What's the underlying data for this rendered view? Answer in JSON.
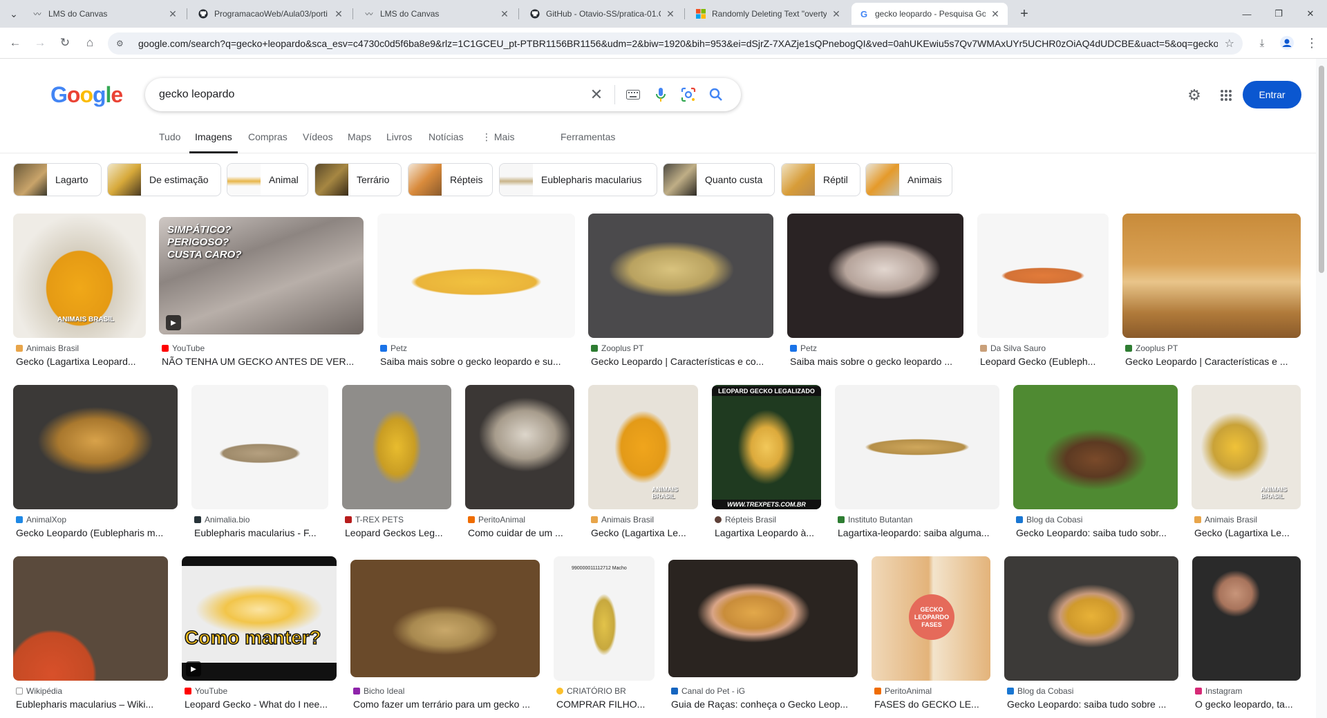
{
  "browser": {
    "tabs": [
      {
        "title": "LMS do Canvas",
        "icon": "canvas-icon"
      },
      {
        "title": "ProgramacaoWeb/Aula03/porti",
        "icon": "github-icon"
      },
      {
        "title": "LMS do Canvas",
        "icon": "canvas-icon"
      },
      {
        "title": "GitHub - Otavio-SS/pratica-01.C",
        "icon": "github-icon"
      },
      {
        "title": "Randomly Deleting Text \"overty",
        "icon": "microsoft-icon"
      },
      {
        "title": "gecko leopardo - Pesquisa Goo",
        "icon": "google-icon",
        "active": true
      }
    ],
    "url": "google.com/search?q=gecko+leopardo&sca_esv=c4730c0d5f6ba8e9&rlz=1C1GCEU_pt-PTBR1156BR1156&udm=2&biw=1920&bih=953&ei=dSjrZ-7XAZje1sQPnebogQI&ved=0ahUKEwiu5s7Qv7WMAxUYr5UCHR0zOiAQ4dUDCBE&uact=5&oq=gecko..."
  },
  "google": {
    "logo_letters": [
      {
        "char": "G",
        "color": "#4285f4"
      },
      {
        "char": "o",
        "color": "#ea4335"
      },
      {
        "char": "o",
        "color": "#fbbc05"
      },
      {
        "char": "g",
        "color": "#4285f4"
      },
      {
        "char": "l",
        "color": "#34a853"
      },
      {
        "char": "e",
        "color": "#ea4335"
      }
    ],
    "query": "gecko leopardo",
    "signin_label": "Entrar",
    "nav_tabs": [
      "Tudo",
      "Imagens",
      "Compras",
      "Vídeos",
      "Maps",
      "Livros",
      "Notícias",
      "⋮ Mais",
      "Ferramentas"
    ],
    "active_tab": "Imagens",
    "chips": [
      "Lagarto",
      "De estimação",
      "Animal",
      "Terrário",
      "Répteis",
      "Eublepharis macularius",
      "Quanto custa",
      "Réptil",
      "Animais"
    ]
  },
  "results": [
    {
      "source": "Animais Brasil",
      "caption": "Gecko (Lagartixa Leopard..."
    },
    {
      "source": "YouTube",
      "caption": "NÃO TENHA UM GECKO ANTES DE VER...",
      "overlay": "SIMPÁTICO?\nPERIGOSO?\nCUSTA CARO?",
      "video": true
    },
    {
      "source": "Petz",
      "caption": "Saiba mais sobre o gecko leopardo e su..."
    },
    {
      "source": "Zooplus PT",
      "caption": "Gecko Leopardo | Características e co..."
    },
    {
      "source": "Petz",
      "caption": "Saiba mais sobre o gecko leopardo ..."
    },
    {
      "source": "Da Silva Sauro",
      "caption": "Leopard Gecko (Eubleph..."
    },
    {
      "source": "Zooplus PT",
      "caption": "Gecko Leopardo | Características e ..."
    },
    {
      "source": "AnimalXop",
      "caption": "Gecko Leopardo (Eublepharis m..."
    },
    {
      "source": "Animalia.bio",
      "caption": "Eublepharis macularius - F..."
    },
    {
      "source": "T-REX PETS",
      "caption": "Leopard Geckos Leg..."
    },
    {
      "source": "PeritoAnimal",
      "caption": "Como cuidar de um ..."
    },
    {
      "source": "Animais Brasil",
      "caption": "Gecko (Lagartixa Le..."
    },
    {
      "source": "Répteis Brasil",
      "caption": "Lagartixa Leopardo à...",
      "overlay": "LEOPARD GECKO LEGALIZADO"
    },
    {
      "source": "Instituto Butantan",
      "caption": "Lagartixa-leopardo: saiba alguma..."
    },
    {
      "source": "Blog da Cobasi",
      "caption": "Gecko Leopardo: saiba tudo sobr..."
    },
    {
      "source": "Animais Brasil",
      "caption": "Gecko (Lagartixa Le..."
    },
    {
      "source": "Wikipédia",
      "caption": "Eublepharis macularius – Wiki..."
    },
    {
      "source": "YouTube",
      "caption": "Leopard Gecko - What do I nee...",
      "overlay": "Como manter?",
      "video": true
    },
    {
      "source": "Bicho Ideal",
      "caption": "Como fazer um terrário para um gecko ..."
    },
    {
      "source": "CRIATÓRIO BR",
      "caption": "COMPRAR FILHO..."
    },
    {
      "source": "Canal do Pet - iG",
      "caption": "Guia de Raças: conheça o Gecko Leop..."
    },
    {
      "source": "PeritoAnimal",
      "caption": "FASES do GECKO LE...",
      "overlay": "GECKO LEOPARDO FASES"
    },
    {
      "source": "Blog da Cobasi",
      "caption": "Gecko Leopardo: saiba tudo sobre ..."
    },
    {
      "source": "Instagram",
      "caption": "O gecko leopardo, ta..."
    }
  ],
  "image_texts": {
    "watermark": "ANIMAIS BRASIL",
    "trexpets": "WWW.TREXPETS.COM.BR",
    "criatorio_tag": "990000011112712 Macho"
  }
}
